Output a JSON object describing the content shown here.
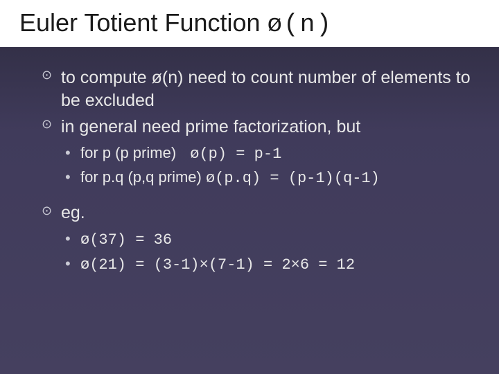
{
  "slide": {
    "title_text": "Euler Totient Function ",
    "title_code": "ø(n)",
    "bullets": [
      {
        "text": "to compute ø(n) need to count number of elements to be excluded"
      },
      {
        "text": "in general need prime factorization, but"
      }
    ],
    "sub_bullets": [
      {
        "plain": "for p (p prime)        ",
        "mono": "ø(p) = p-1"
      },
      {
        "plain": "for p.q (p,q prime)   ",
        "mono": "ø(p.q) = (p-1)(q-1)"
      }
    ],
    "eg_label": "eg.",
    "eg_items": [
      {
        "mono": "ø(37) = 36"
      },
      {
        "mono": "ø(21) = (3-1)×(7-1) = 2×6 = 12"
      }
    ]
  }
}
